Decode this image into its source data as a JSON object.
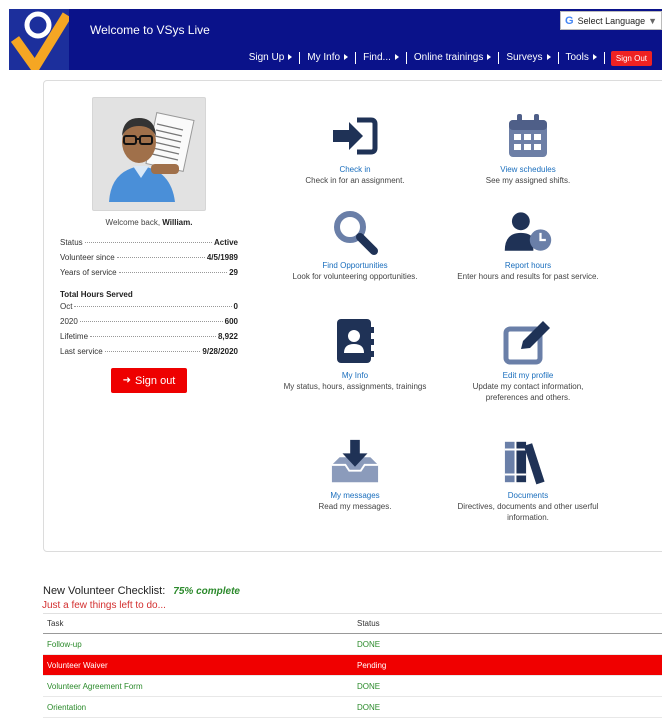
{
  "header": {
    "title": "Welcome to VSys Live",
    "translate": {
      "label": "Select Language",
      "g": "G",
      "caret": "▼"
    },
    "nav": [
      {
        "label": "Sign Up"
      },
      {
        "label": "My Info"
      },
      {
        "label": "Find..."
      },
      {
        "label": "Online trainings"
      },
      {
        "label": "Surveys"
      },
      {
        "label": "Tools"
      }
    ],
    "signout_label": "Sign Out"
  },
  "profile": {
    "welcome_prefix": "Welcome back, ",
    "name": "William.",
    "stats": [
      {
        "label": "Status",
        "value": "Active"
      },
      {
        "label": "Volunteer since",
        "value": "4/5/1989"
      },
      {
        "label": "Years of service",
        "value": "29"
      }
    ],
    "hours_heading": "Total Hours Served",
    "hours": [
      {
        "label": "Oct",
        "value": "0"
      },
      {
        "label": "2020",
        "value": "600"
      },
      {
        "label": "Lifetime",
        "value": "8,922"
      },
      {
        "label": "Last service",
        "value": "9/28/2020"
      }
    ],
    "signout_button": "Sign out",
    "signout_arrow": "➜"
  },
  "tiles": [
    {
      "title": "Check in",
      "desc": "Check in for an assignment.",
      "icon": "sign-in-icon"
    },
    {
      "title": "View schedules",
      "desc": "See my assigned shifts.",
      "icon": "calendar-icon"
    },
    {
      "title": "Find Opportunities",
      "desc": "Look for volunteering opportunities.",
      "icon": "search-icon"
    },
    {
      "title": "Report hours",
      "desc": "Enter hours and results for past service.",
      "icon": "user-clock-icon"
    },
    {
      "title": "My Info",
      "desc": "My status, hours, assignments, trainings",
      "icon": "contact-book-icon"
    },
    {
      "title": "Edit my profile",
      "desc": "Update my contact information, preferences and others.",
      "icon": "edit-icon"
    },
    {
      "title": "My messages",
      "desc": "Read my messages.",
      "icon": "inbox-download-icon"
    },
    {
      "title": "Documents",
      "desc": "Directives, documents and other userful information.",
      "icon": "books-icon"
    }
  ],
  "checklist": {
    "title": "New Volunteer Checklist:",
    "percent": "75% complete",
    "subtitle": "Just a few things left to do...",
    "columns": [
      "Task",
      "Status"
    ],
    "rows": [
      {
        "task": "Follow-up",
        "status": "DONE"
      },
      {
        "task": "Volunteer Waiver",
        "status": "Pending"
      },
      {
        "task": "Volunteer Agreement Form",
        "status": "DONE"
      },
      {
        "task": "Orientation",
        "status": "DONE"
      }
    ]
  },
  "colors": {
    "header_bg": "#0a128a",
    "accent_red": "#ee0000",
    "link_blue": "#1a6ebd",
    "done_green": "#2a8a2a",
    "icon_navy": "#1f3256"
  }
}
